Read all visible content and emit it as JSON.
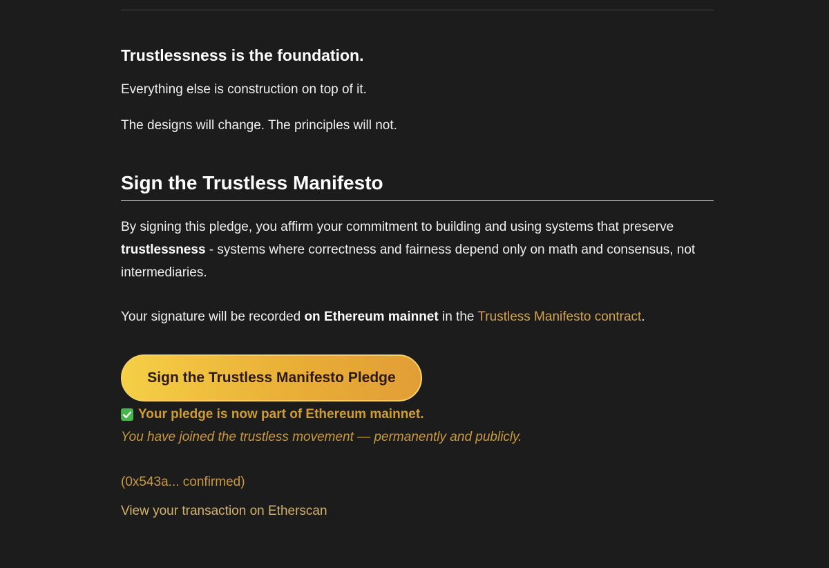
{
  "foundation": {
    "heading": "Trustlessness is the foundation.",
    "paragraph_1": "Everything else is construction on top of it.",
    "paragraph_2": "The designs will change. The principles will not."
  },
  "sign_section": {
    "heading": "Sign the Trustless Manifesto",
    "pledge_intro": "By signing this pledge, you affirm your commitment to building and using systems that preserve",
    "pledge_bold": "trustlessness",
    "pledge_rest": " - systems where correctness and fairness depend only on math and consensus, not intermediaries.",
    "record_prefix": "Your signature will be recorded ",
    "record_bold": "on Ethereum mainnet",
    "record_middle": " in the ",
    "contract_link": "Trustless Manifesto contract",
    "record_suffix": ".",
    "sign_button": "Sign the Trustless Manifesto Pledge"
  },
  "status": {
    "success_message": "Your pledge is now part of Ethereum mainnet.",
    "joined_message": "You have joined the trustless movement — permanently and publicly.",
    "tx_status": "(0x543a... confirmed)",
    "etherscan_link": "View your transaction on Etherscan"
  },
  "colors": {
    "background": "#1c1c1c",
    "accent_gold": "#d19e2e",
    "check_green": "#45b649"
  }
}
